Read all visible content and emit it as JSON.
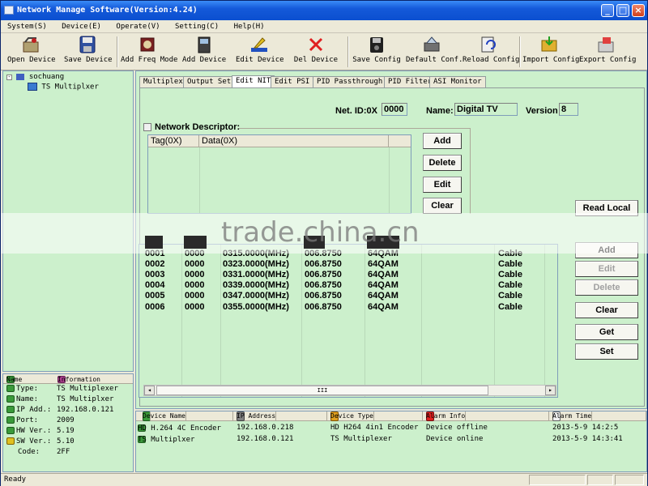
{
  "window": {
    "title": "Network Manage Software(Version:4.24)"
  },
  "menu": [
    "System(S)",
    "Device(E)",
    "Operate(V)",
    "Setting(C)",
    "Help(H)"
  ],
  "toolbar": [
    "Open Device",
    "Save Device",
    "Add Freq Mode",
    "Add Device",
    "Edit Device",
    "Del Device",
    "Save Config",
    "Default Conf.",
    "Reload Config",
    "Import Config",
    "Export Config"
  ],
  "tree": {
    "root": "sochuang",
    "child": "TS Multiplxer"
  },
  "info": {
    "headers": [
      "Name",
      "Information"
    ],
    "rows": [
      {
        "k": "Type:",
        "v": "TS Multiplexer"
      },
      {
        "k": "Name:",
        "v": "TS Multiplxer"
      },
      {
        "k": "IP Add.:",
        "v": "192.168.0.121"
      },
      {
        "k": "Port:",
        "v": "2009"
      },
      {
        "k": "HW Ver.:",
        "v": "5.19"
      },
      {
        "k": "SW Ver.:",
        "v": "5.10"
      },
      {
        "k": "Code:",
        "v": "2FF"
      }
    ]
  },
  "tabs": [
    "Multiplex",
    "Output Set",
    "Edit NIT",
    "Edit PSI",
    "PID Passthrough",
    "PID Filter",
    "ASI Monitor"
  ],
  "nit": {
    "net_id_label": "Net. ID:0X",
    "net_id": "0000",
    "name_label": "Name:",
    "name": "Digital TV",
    "version_label": "Version",
    "version": "8",
    "descriptor_label": "Network Descriptor:",
    "desc_headers": [
      "Tag(0X)",
      "Data(0X)"
    ],
    "desc_buttons": [
      "Add",
      "Delete",
      "Edit",
      "Clear"
    ],
    "read_local": "Read Local",
    "right_buttons": [
      "Add",
      "Edit",
      "Delete",
      "Clear",
      "Get",
      "Set"
    ],
    "rows": [
      [
        "0001",
        "0000",
        "0315.0000(MHz)",
        "006.8750",
        "64QAM",
        "Cable"
      ],
      [
        "0002",
        "0000",
        "0323.0000(MHz)",
        "006.8750",
        "64QAM",
        "Cable"
      ],
      [
        "0003",
        "0000",
        "0331.0000(MHz)",
        "006.8750",
        "64QAM",
        "Cable"
      ],
      [
        "0004",
        "0000",
        "0339.0000(MHz)",
        "006.8750",
        "64QAM",
        "Cable"
      ],
      [
        "0005",
        "0000",
        "0347.0000(MHz)",
        "006.8750",
        "64QAM",
        "Cable"
      ],
      [
        "0006",
        "0000",
        "0355.0000(MHz)",
        "006.8750",
        "64QAM",
        "Cable"
      ]
    ],
    "scroll_grip": "III"
  },
  "devices": {
    "headers": [
      "Device Name",
      "IP Address",
      "Device Type",
      "Alarm Info",
      "Alarm Time"
    ],
    "rows": [
      [
        "HD H.264 4C Encoder",
        "192.168.0.218",
        "HD H264 4in1 Encoder",
        "Device offline",
        "2013-5-9 14:2:5"
      ],
      [
        "TS Multiplxer",
        "192.168.0.121",
        "TS Multiplexer",
        "Device online",
        "2013-5-9 14:3:41"
      ]
    ]
  },
  "status": "Ready",
  "watermark": "trade.china.cn"
}
